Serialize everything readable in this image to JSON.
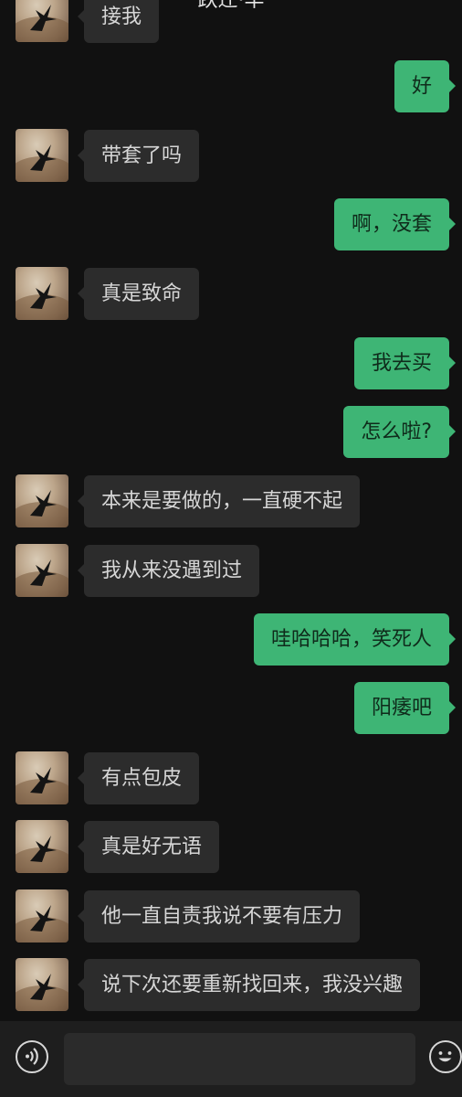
{
  "header": {
    "back_glyph": "‹",
    "title": "跃迁·羊"
  },
  "messages": [
    {
      "side": "in",
      "text": "接我"
    },
    {
      "side": "out",
      "text": "好"
    },
    {
      "side": "in",
      "text": "带套了吗"
    },
    {
      "side": "out",
      "text": "啊，没套"
    },
    {
      "side": "in",
      "text": "真是致命"
    },
    {
      "side": "out",
      "text": "我去买"
    },
    {
      "side": "out",
      "text": "怎么啦?"
    },
    {
      "side": "in",
      "text": "本来是要做的，一直硬不起"
    },
    {
      "side": "in",
      "text": "我从来没遇到过"
    },
    {
      "side": "out",
      "text": "哇哈哈哈，笑死人"
    },
    {
      "side": "out",
      "text": "阳痿吧"
    },
    {
      "side": "in",
      "text": "有点包皮"
    },
    {
      "side": "in",
      "text": "真是好无语"
    },
    {
      "side": "in",
      "text": "他一直自责我说不要有压力"
    },
    {
      "side": "in",
      "text": "说下次还要重新找回来，我没兴趣"
    }
  ],
  "input_bar": {
    "voice_icon": "voice-icon",
    "emoji_icon": "emoji-icon",
    "text_value": ""
  },
  "colors": {
    "background": "#111111",
    "incoming_bubble": "#2c2c2c",
    "outgoing_bubble": "#3eb575",
    "input_bar": "#1e1e1e"
  }
}
